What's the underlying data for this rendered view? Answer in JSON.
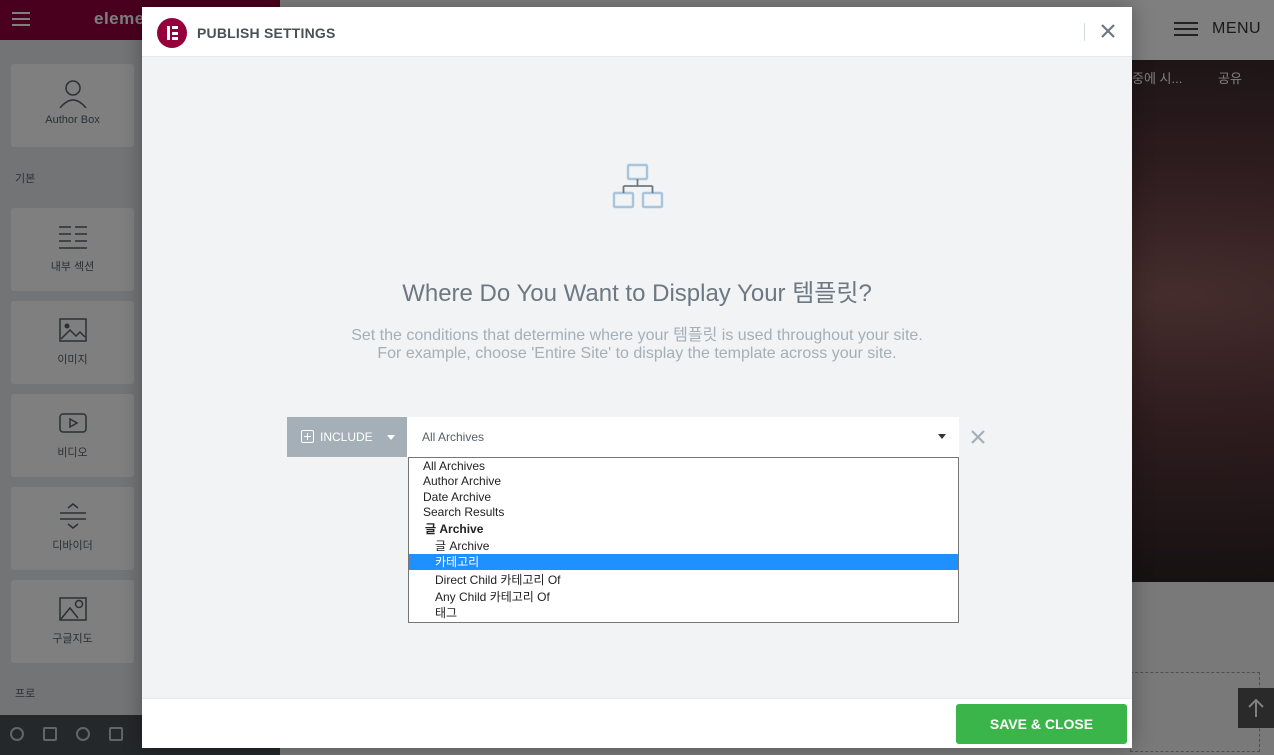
{
  "editor": {
    "logo_text": "eleme",
    "widgets": [
      {
        "label": "Author Box",
        "icon": "user-icon"
      },
      {
        "label": "내부 섹션",
        "icon": "columns-icon"
      },
      {
        "label": "이미지",
        "icon": "image-icon"
      },
      {
        "label": "비디오",
        "icon": "video-icon"
      },
      {
        "label": "디바이더",
        "icon": "divider-icon"
      },
      {
        "label": "구글지도",
        "icon": "map-icon"
      }
    ],
    "section_basic": "기본",
    "section_pro": "프로",
    "canvas": {
      "menu_label": "MENU",
      "nav_items": [
        "중에 시...",
        "공유"
      ]
    }
  },
  "modal": {
    "title": "PUBLISH SETTINGS",
    "headline": "Where Do You Want to Display Your 템플릿?",
    "description_line1": "Set the conditions that determine where your 템플릿 is used throughout your site.",
    "description_line2": "For example, choose 'Entire Site' to display the template across your site.",
    "condition": {
      "type_label": "INCLUDE",
      "selected_value": "All Archives"
    },
    "dropdown_options": [
      {
        "label": "All Archives",
        "level": 0
      },
      {
        "label": "Author Archive",
        "level": 0
      },
      {
        "label": "Date Archive",
        "level": 0
      },
      {
        "label": "Search Results",
        "level": 0
      },
      {
        "label": "글 Archive",
        "level": "group"
      },
      {
        "label": "글 Archive",
        "level": 1
      },
      {
        "label": "카테고리",
        "level": 1,
        "selected": true
      },
      {
        "label": "Direct Child 카테고리 Of",
        "level": 1
      },
      {
        "label": "Any Child 카테고리 Of",
        "level": 1
      },
      {
        "label": "태그",
        "level": 1
      }
    ],
    "save_label": "SAVE & CLOSE"
  },
  "colors": {
    "brand": "#93003c",
    "save_green": "#39b54a",
    "highlight_blue": "#1e90ff"
  }
}
